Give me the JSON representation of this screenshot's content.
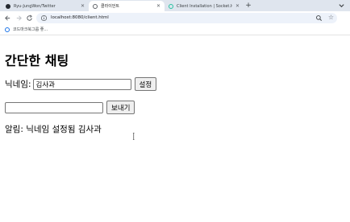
{
  "browser": {
    "tabs": [
      {
        "title": "Ryu-JungWon/Twitter",
        "favicon_color": "#24292f",
        "active": false
      },
      {
        "title": "클라이언트",
        "favicon_color": "#5f6368",
        "active": true
      },
      {
        "title": "Client Installation | Socket.IO",
        "favicon_color": "#25c2a0",
        "active": false
      }
    ],
    "url": "localhost:8080/client.html",
    "bookmark_label": "코드마크북그룹 좋..."
  },
  "page": {
    "heading": "간단한 채팅",
    "nickname_label": "닉네임:",
    "nickname_value": "김사과",
    "set_button": "설정",
    "message_value": "",
    "send_button": "보내기",
    "notice": "알림: 닉네임 설정됨 김사과"
  }
}
